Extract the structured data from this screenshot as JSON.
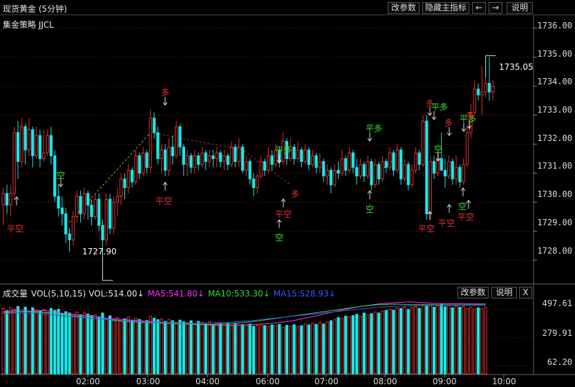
{
  "header": {
    "title": "现货黄金 (5分钟)",
    "buttons": {
      "change_params": "改参数",
      "hide_indicator": "隐藏主指标",
      "prev": "←",
      "next": "→",
      "help": "说明"
    }
  },
  "strategy": {
    "label": "集金策略 JJCL"
  },
  "colors": {
    "up": "#e23232",
    "down": "#1ae6e6",
    "buy": "#e23232",
    "sell": "#2ee62e",
    "ma5": "#ff33ff",
    "ma10": "#33dd33",
    "ma15": "#3355ff",
    "grid": "#7a1515"
  },
  "price_axis": {
    "labels": [
      "1736.00",
      "1735.00",
      "1734.00",
      "1733.00",
      "1732.00",
      "1731.00",
      "1730.00",
      "1729.00",
      "1728.00"
    ]
  },
  "time_axis": {
    "labels": [
      "02:00",
      "03:00",
      "04:00",
      "06:00",
      "07:00",
      "08:00",
      "09:00",
      "10:00"
    ]
  },
  "markers": {
    "last_price": "1735.05",
    "low_price": "1727.90"
  },
  "signals": {
    "duo": "多",
    "kong": "空",
    "ping_kong": "平空",
    "ping_duo": "平多"
  },
  "volume_panel": {
    "name": "成交量",
    "vol_params": "VOL(5,10,15)",
    "vol": "VOL:514.00↓",
    "ma5": "MA5:541.80↓",
    "ma10": "MA10:533.30↓",
    "ma15": "MA15:528.93↓",
    "buttons": {
      "change_params": "改参数",
      "help": "说明",
      "close": "X"
    },
    "axis_labels": [
      "497.61",
      "279.91",
      "62.20"
    ]
  },
  "chart_data": {
    "type": "candlestick",
    "title": "现货黄金 (5分钟)",
    "ylim": [
      1727.2,
      1736.4
    ],
    "candles": [
      [
        1729.9,
        1730.5,
        1729.2,
        1730.3
      ],
      [
        1730.3,
        1730.6,
        1729.6,
        1729.9
      ],
      [
        1729.9,
        1730.6,
        1729.5,
        1730.3
      ],
      [
        1730.3,
        1732.6,
        1730.1,
        1732.4
      ],
      [
        1732.4,
        1732.8,
        1730.8,
        1731.4
      ],
      [
        1731.4,
        1732.9,
        1731.2,
        1732.6
      ],
      [
        1732.6,
        1732.7,
        1731.3,
        1731.8
      ],
      [
        1731.8,
        1732.9,
        1731.6,
        1732.5
      ],
      [
        1732.5,
        1732.6,
        1731.2,
        1731.6
      ],
      [
        1731.6,
        1732.6,
        1731.5,
        1732.3
      ],
      [
        1732.3,
        1732.5,
        1731.2,
        1731.5
      ],
      [
        1731.5,
        1732.5,
        1731.4,
        1731.7
      ],
      [
        1731.7,
        1732.5,
        1731.6,
        1732.3
      ],
      [
        1732.3,
        1732.6,
        1731.3,
        1731.6
      ],
      [
        1731.6,
        1731.8,
        1730.0,
        1730.2
      ],
      [
        1730.2,
        1730.6,
        1729.5,
        1729.8
      ],
      [
        1729.8,
        1730.2,
        1729.2,
        1729.6
      ],
      [
        1729.6,
        1729.8,
        1728.6,
        1728.9
      ],
      [
        1728.9,
        1729.1,
        1728.3,
        1728.7
      ],
      [
        1728.7,
        1729.7,
        1728.5,
        1729.5
      ],
      [
        1729.5,
        1730.4,
        1729.3,
        1730.2
      ],
      [
        1730.2,
        1730.4,
        1729.3,
        1729.6
      ],
      [
        1729.6,
        1730.5,
        1729.4,
        1730.3
      ],
      [
        1730.3,
        1730.4,
        1729.4,
        1729.9
      ],
      [
        1729.9,
        1730.1,
        1729.2,
        1729.5
      ],
      [
        1729.5,
        1730.3,
        1729.4,
        1730.1
      ],
      [
        1730.1,
        1730.3,
        1729.0,
        1729.2
      ],
      [
        1729.2,
        1729.4,
        1728.4,
        1728.7
      ],
      [
        1728.7,
        1730.3,
        1728.5,
        1730.1
      ],
      [
        1730.1,
        1730.3,
        1728.9,
        1729.1
      ],
      [
        1729.1,
        1730.2,
        1728.9,
        1730.0
      ],
      [
        1730.0,
        1730.5,
        1729.5,
        1730.2
      ],
      [
        1730.2,
        1731.0,
        1729.9,
        1730.8
      ],
      [
        1730.8,
        1731.0,
        1730.1,
        1730.5
      ],
      [
        1730.5,
        1731.3,
        1730.3,
        1731.1
      ],
      [
        1731.1,
        1731.2,
        1730.5,
        1730.7
      ],
      [
        1730.7,
        1731.8,
        1730.6,
        1731.6
      ],
      [
        1731.6,
        1731.7,
        1730.8,
        1731.0
      ],
      [
        1731.0,
        1731.9,
        1730.9,
        1731.7
      ],
      [
        1731.7,
        1731.8,
        1731.0,
        1731.2
      ],
      [
        1731.2,
        1733.2,
        1731.0,
        1732.9
      ],
      [
        1732.9,
        1733.1,
        1732.2,
        1732.4
      ],
      [
        1732.4,
        1732.6,
        1731.3,
        1731.5
      ],
      [
        1731.5,
        1732.0,
        1731.0,
        1731.8
      ],
      [
        1731.8,
        1732.0,
        1730.9,
        1731.1
      ],
      [
        1731.1,
        1732.2,
        1730.9,
        1731.9
      ],
      [
        1731.9,
        1732.3,
        1731.3,
        1731.6
      ],
      [
        1731.6,
        1732.8,
        1731.5,
        1732.6
      ],
      [
        1732.6,
        1732.7,
        1731.6,
        1731.9
      ],
      [
        1731.9,
        1732.0,
        1730.9,
        1731.3
      ],
      [
        1731.3,
        1731.8,
        1730.9,
        1731.6
      ],
      [
        1731.6,
        1731.7,
        1731.0,
        1731.2
      ],
      [
        1731.2,
        1731.8,
        1731.0,
        1731.6
      ],
      [
        1731.6,
        1731.7,
        1731.1,
        1731.3
      ],
      [
        1731.3,
        1731.9,
        1731.2,
        1731.7
      ],
      [
        1731.7,
        1731.8,
        1731.1,
        1731.4
      ],
      [
        1731.4,
        1731.8,
        1731.2,
        1731.6
      ],
      [
        1731.6,
        1731.8,
        1731.2,
        1731.5
      ],
      [
        1731.5,
        1731.9,
        1731.2,
        1731.7
      ],
      [
        1731.7,
        1731.8,
        1731.2,
        1731.4
      ],
      [
        1731.4,
        1731.8,
        1731.1,
        1731.6
      ],
      [
        1731.6,
        1731.7,
        1731.1,
        1731.3
      ],
      [
        1731.3,
        1732.1,
        1731.2,
        1731.9
      ],
      [
        1731.9,
        1732.0,
        1731.2,
        1731.4
      ],
      [
        1731.4,
        1732.2,
        1731.2,
        1731.9
      ],
      [
        1731.9,
        1732.0,
        1731.0,
        1731.1
      ],
      [
        1731.1,
        1731.6,
        1730.9,
        1731.4
      ],
      [
        1731.4,
        1731.5,
        1730.6,
        1730.8
      ],
      [
        1730.8,
        1731.0,
        1730.2,
        1730.5
      ],
      [
        1730.5,
        1731.0,
        1730.3,
        1730.9
      ],
      [
        1730.9,
        1731.6,
        1730.8,
        1731.4
      ],
      [
        1731.4,
        1731.5,
        1730.9,
        1731.1
      ],
      [
        1731.1,
        1731.9,
        1731.0,
        1731.6
      ],
      [
        1731.6,
        1731.8,
        1731.1,
        1731.3
      ],
      [
        1731.3,
        1732.0,
        1731.2,
        1731.8
      ],
      [
        1731.8,
        1731.9,
        1731.2,
        1731.4
      ],
      [
        1731.4,
        1732.4,
        1731.3,
        1732.1
      ],
      [
        1732.1,
        1732.2,
        1731.3,
        1731.5
      ],
      [
        1731.5,
        1732.2,
        1731.4,
        1731.9
      ],
      [
        1731.9,
        1732.0,
        1731.3,
        1731.5
      ],
      [
        1731.5,
        1732.1,
        1731.4,
        1731.8
      ],
      [
        1731.8,
        1731.9,
        1731.2,
        1731.4
      ],
      [
        1731.4,
        1732.0,
        1731.3,
        1731.8
      ],
      [
        1731.8,
        1731.9,
        1731.1,
        1731.3
      ],
      [
        1731.3,
        1731.8,
        1731.2,
        1731.6
      ],
      [
        1731.6,
        1731.7,
        1731.0,
        1731.2
      ],
      [
        1731.2,
        1731.7,
        1731.0,
        1731.4
      ],
      [
        1731.4,
        1731.5,
        1730.7,
        1730.9
      ],
      [
        1730.9,
        1731.3,
        1730.6,
        1731.1
      ],
      [
        1731.1,
        1731.2,
        1730.3,
        1730.6
      ],
      [
        1730.6,
        1731.3,
        1730.5,
        1731.1
      ],
      [
        1731.1,
        1731.4,
        1730.8,
        1731.0
      ],
      [
        1731.0,
        1731.8,
        1730.9,
        1731.5
      ],
      [
        1731.5,
        1731.6,
        1730.9,
        1731.1
      ],
      [
        1731.1,
        1731.9,
        1731.0,
        1731.7
      ],
      [
        1731.7,
        1731.8,
        1731.0,
        1731.2
      ],
      [
        1731.2,
        1731.5,
        1730.6,
        1730.9
      ],
      [
        1730.9,
        1731.5,
        1730.8,
        1731.3
      ],
      [
        1731.3,
        1731.4,
        1730.7,
        1730.9
      ],
      [
        1730.9,
        1731.6,
        1730.8,
        1731.4
      ],
      [
        1731.4,
        1731.5,
        1730.4,
        1730.6
      ],
      [
        1730.6,
        1731.5,
        1730.5,
        1731.3
      ],
      [
        1731.3,
        1731.4,
        1730.6,
        1730.8
      ],
      [
        1730.8,
        1731.6,
        1730.7,
        1731.4
      ],
      [
        1731.4,
        1731.5,
        1731.0,
        1731.2
      ],
      [
        1731.2,
        1731.9,
        1731.1,
        1731.7
      ],
      [
        1731.7,
        1731.8,
        1730.9,
        1731.1
      ],
      [
        1731.1,
        1732.0,
        1731.0,
        1731.8
      ],
      [
        1731.8,
        1731.9,
        1730.6,
        1730.8
      ],
      [
        1730.8,
        1731.5,
        1730.7,
        1731.3
      ],
      [
        1731.3,
        1731.4,
        1730.4,
        1730.6
      ],
      [
        1730.6,
        1731.3,
        1730.5,
        1731.1
      ],
      [
        1731.1,
        1731.9,
        1731.0,
        1731.7
      ],
      [
        1731.7,
        1731.8,
        1731.1,
        1731.3
      ],
      [
        1731.3,
        1733.0,
        1731.2,
        1732.8
      ],
      [
        1732.8,
        1733.0,
        1729.4,
        1729.6
      ],
      [
        1729.6,
        1731.6,
        1729.4,
        1731.4
      ],
      [
        1731.4,
        1731.6,
        1730.8,
        1731.0
      ],
      [
        1731.0,
        1731.7,
        1730.9,
        1731.5
      ],
      [
        1731.5,
        1732.4,
        1731.3,
        1731.1
      ],
      [
        1731.1,
        1731.5,
        1730.5,
        1730.9
      ],
      [
        1730.9,
        1731.6,
        1730.8,
        1731.4
      ],
      [
        1731.4,
        1731.5,
        1730.6,
        1730.8
      ],
      [
        1730.8,
        1731.6,
        1730.6,
        1731.2
      ],
      [
        1731.2,
        1731.3,
        1730.5,
        1730.7
      ],
      [
        1730.7,
        1731.5,
        1730.6,
        1731.3
      ],
      [
        1731.3,
        1732.6,
        1731.2,
        1732.4
      ],
      [
        1732.4,
        1733.4,
        1732.2,
        1733.1
      ],
      [
        1733.1,
        1734.2,
        1733.0,
        1733.9
      ],
      [
        1733.9,
        1734.1,
        1733.5,
        1733.7
      ],
      [
        1733.7,
        1734.7,
        1733.0,
        1733.8
      ],
      [
        1733.8,
        1734.3,
        1733.6,
        1734.1
      ],
      [
        1734.1,
        1735.0,
        1733.5,
        1733.8
      ],
      [
        1733.8,
        1734.2,
        1733.5,
        1734.0
      ]
    ],
    "volume_ylim": [
      0,
      560
    ],
    "volumes": [
      505,
      488,
      512,
      498,
      520,
      480,
      515,
      470,
      510,
      495,
      485,
      500,
      475,
      505,
      490,
      498,
      465,
      480,
      470,
      460,
      478,
      455,
      470,
      462,
      450,
      455,
      440,
      470,
      430,
      448,
      420,
      435,
      410,
      425,
      440,
      415,
      430,
      420,
      400,
      412,
      445,
      430,
      418,
      425,
      405,
      420,
      410,
      398,
      415,
      402,
      395,
      410,
      390,
      405,
      398,
      385,
      402,
      380,
      395,
      388,
      378,
      390,
      370,
      385,
      375,
      380,
      370,
      385,
      368,
      375,
      380,
      372,
      365,
      378,
      370,
      382,
      360,
      375,
      368,
      380,
      365,
      372,
      385,
      378,
      390,
      382,
      398,
      385,
      400,
      410,
      420,
      435,
      428,
      445,
      440,
      450,
      460,
      445,
      470,
      455,
      465,
      478,
      470,
      485,
      490,
      500,
      492,
      510,
      505,
      515,
      498,
      512,
      520,
      505,
      535,
      522,
      530,
      515,
      525,
      540,
      518,
      528,
      510,
      525,
      515,
      520,
      505,
      515,
      498,
      510,
      505,
      514
    ],
    "ma5": [
      480,
      482,
      486,
      490,
      495,
      492,
      488,
      485,
      484,
      486,
      488,
      490,
      487,
      484,
      478,
      472,
      468,
      465,
      462,
      458,
      455,
      452,
      450,
      448,
      446,
      442,
      438,
      434,
      430,
      428,
      425,
      422,
      420,
      418,
      416,
      414,
      412,
      410,
      408,
      406,
      404,
      402,
      400,
      398,
      396,
      394,
      392,
      390,
      388,
      386,
      384,
      383,
      382,
      381,
      380,
      379,
      378,
      377,
      376,
      376,
      375,
      375,
      376,
      377,
      378,
      379,
      380,
      381,
      382,
      383,
      384,
      386,
      388,
      390,
      393,
      396,
      400,
      404,
      408,
      412,
      418,
      424,
      430,
      436,
      442,
      448,
      455,
      462,
      468,
      474,
      480,
      486,
      492,
      498,
      504,
      510,
      515,
      520,
      524,
      528,
      532,
      536,
      540,
      542,
      544,
      546,
      548,
      550,
      552,
      554,
      556,
      555,
      553,
      551,
      549,
      547,
      545,
      544,
      543,
      542,
      541,
      541,
      542,
      542,
      542,
      541,
      541,
      541,
      540,
      540,
      540,
      540
    ],
    "ma10": [
      470,
      472,
      475,
      478,
      480,
      481,
      481,
      480,
      479,
      478,
      476,
      474,
      472,
      469,
      466,
      462,
      458,
      454,
      450,
      446,
      443,
      440,
      437,
      434,
      431,
      428,
      425,
      422,
      419,
      416,
      413,
      410,
      408,
      406,
      404,
      402,
      400,
      398,
      397,
      396,
      395,
      394,
      393,
      392,
      391,
      390,
      389,
      388,
      387,
      386,
      385,
      384,
      383,
      382,
      382,
      382,
      382,
      383,
      384,
      385,
      386,
      387,
      389,
      391,
      393,
      395,
      398,
      401,
      404,
      408,
      412,
      416,
      420,
      424,
      428,
      432,
      436,
      440,
      444,
      448,
      452,
      456,
      460,
      464,
      468,
      472,
      476,
      480,
      484,
      488,
      492,
      496,
      500,
      504,
      508,
      512,
      516,
      520,
      524,
      527,
      530,
      532,
      534,
      535,
      536,
      537,
      537,
      537,
      537,
      536,
      536,
      535,
      535,
      534,
      534,
      534,
      534,
      534,
      533,
      533,
      533,
      533,
      533,
      533,
      533,
      533,
      533,
      533,
      533,
      533,
      533,
      533
    ],
    "ma15": [
      465,
      466,
      468,
      469,
      470,
      470,
      470,
      469,
      468,
      467,
      465,
      463,
      461,
      459,
      456,
      453,
      450,
      447,
      444,
      441,
      438,
      435,
      433,
      431,
      429,
      427,
      425,
      423,
      421,
      419,
      417,
      415,
      413,
      411,
      409,
      407,
      405,
      403,
      401,
      400,
      399,
      398,
      397,
      396,
      395,
      394,
      393,
      392,
      391,
      391,
      391,
      391,
      391,
      391,
      392,
      392,
      393,
      394,
      395,
      396,
      397,
      398,
      400,
      402,
      404,
      406,
      408,
      410,
      413,
      416,
      419,
      422,
      425,
      428,
      431,
      434,
      437,
      440,
      443,
      446,
      449,
      452,
      455,
      458,
      461,
      464,
      467,
      470,
      473,
      476,
      479,
      482,
      485,
      488,
      491,
      494,
      497,
      500,
      503,
      506,
      509,
      512,
      514,
      516,
      518,
      520,
      521,
      522,
      523,
      524,
      525,
      526,
      527,
      527,
      528,
      528,
      528,
      529,
      529,
      529,
      529,
      529,
      529,
      529,
      529,
      529,
      529,
      529,
      529,
      529,
      529,
      529
    ]
  }
}
